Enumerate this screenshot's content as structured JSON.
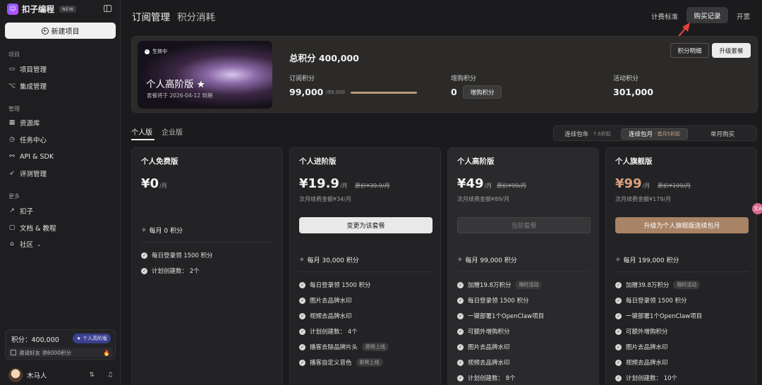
{
  "app": {
    "name": "扣子编程",
    "badge": "NEW",
    "new_project": "新建项目"
  },
  "sidebar": {
    "sections": [
      {
        "title": "项目",
        "items": [
          {
            "label": "项目管理",
            "icon": "folder-icon"
          },
          {
            "label": "集成管理",
            "icon": "plug-icon"
          }
        ]
      },
      {
        "title": "管理",
        "items": [
          {
            "label": "资源库",
            "icon": "grid-icon"
          },
          {
            "label": "任务中心",
            "icon": "clock-icon"
          },
          {
            "label": "API & SDK",
            "icon": "nodes-icon"
          },
          {
            "label": "评测管理",
            "icon": "rocket-icon"
          }
        ]
      },
      {
        "title": "更多",
        "items": [
          {
            "label": "扣子",
            "icon": "arrow-icon"
          },
          {
            "label": "文档 & 教程",
            "icon": "book-icon"
          },
          {
            "label": "社区",
            "icon": "community-icon"
          }
        ]
      }
    ],
    "points_label": "积分：400,000",
    "plan_tag": "个人高阶版",
    "invite": "邀请好友 领6000积分",
    "user_name": "木马人"
  },
  "header": {
    "tabs": [
      "订阅管理",
      "积分消耗"
    ],
    "links": [
      "计费标准",
      "购买记录",
      "开票"
    ]
  },
  "summary": {
    "status": "生效中",
    "plan_name": "个人高阶版 ★",
    "expire": "套餐将于 2026-04-12 到期",
    "total": "总积分  400,000",
    "subscription_label": "订阅积分",
    "subscription_value": "99,000",
    "subscription_total": "/99,000",
    "subscription_progress": 1.0,
    "addon_label": "增购积分",
    "addon_value": "0",
    "addon_button": "增购积分",
    "activity_label": "活动积分",
    "activity_value": "301,000",
    "detail_button": "积分明细",
    "upgrade_button": "升级套餐"
  },
  "plan_tabs": [
    "个人版",
    "企业版"
  ],
  "billing": [
    {
      "label": "连续包年",
      "discount": "· 7.6折起"
    },
    {
      "label": "连续包月",
      "discount": "· 首月5折起"
    },
    {
      "label": "单月购买",
      "discount": ""
    }
  ],
  "plans": [
    {
      "title": "个人免费版",
      "price": "¥0",
      "per": "/月",
      "orig": "",
      "renew": "",
      "button": "",
      "monthly": "每月 0 积分",
      "features": [
        {
          "text": "每日登录领 1500 积分",
          "tag": ""
        },
        {
          "text": "计划创建数： 2个",
          "tag": ""
        }
      ]
    },
    {
      "title": "个人进阶版",
      "price": "¥19.9",
      "per": "/月",
      "orig": "原价¥39.9/月",
      "renew": "次月续费金额¥34/月",
      "button": "变更为该套餐",
      "monthly": "每月 30,000 积分",
      "features": [
        {
          "text": "每日登录领 1500 积分",
          "tag": ""
        },
        {
          "text": "图片去品牌水印",
          "tag": ""
        },
        {
          "text": "视频去品牌水印",
          "tag": ""
        },
        {
          "text": "计划创建数： 4个",
          "tag": ""
        },
        {
          "text": "播客去除品牌片头",
          "tag": "即将上线"
        },
        {
          "text": "播客自定义音色",
          "tag": "即将上线"
        }
      ]
    },
    {
      "title": "个人高阶版",
      "price": "¥49",
      "per": "/月",
      "orig": "原价¥99/月",
      "renew": "次月续费金额¥89/月",
      "button": "当前套餐",
      "monthly": "每月 99,000 积分",
      "features": [
        {
          "text": "加赠19.8万积分",
          "tag": "限时活动"
        },
        {
          "text": "每日登录领 1500 积分",
          "tag": ""
        },
        {
          "text": "一键部署1个OpenClaw项目",
          "tag": ""
        },
        {
          "text": "可额外增购积分",
          "tag": ""
        },
        {
          "text": "图片去品牌水印",
          "tag": ""
        },
        {
          "text": "视频去品牌水印",
          "tag": ""
        },
        {
          "text": "计划创建数： 8个",
          "tag": ""
        }
      ]
    },
    {
      "title": "个人旗舰版",
      "price": "¥99",
      "per": "/月",
      "orig": "原价¥199/月",
      "renew": "次月续费金额¥179/月",
      "button": "升级为个人旗舰版连续包月",
      "monthly": "每月 199,000 积分",
      "features": [
        {
          "text": "加赠39.8万积分",
          "tag": "限时活动"
        },
        {
          "text": "每日登录领 1500 积分",
          "tag": ""
        },
        {
          "text": "一键部署1个OpenClaw项目",
          "tag": ""
        },
        {
          "text": "可额外增购积分",
          "tag": ""
        },
        {
          "text": "图片去品牌水印",
          "tag": ""
        },
        {
          "text": "视频去品牌水印",
          "tag": ""
        },
        {
          "text": "计划创建数： 10个",
          "tag": ""
        }
      ]
    }
  ],
  "colors": {
    "accent_gold": "#a88366",
    "price_gold": "#d9a27e",
    "arrow_red": "#e0403a"
  }
}
